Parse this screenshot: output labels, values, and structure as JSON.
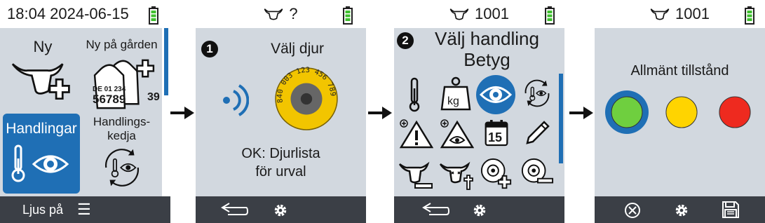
{
  "screen1": {
    "datetime": "18:04 2024-06-15",
    "tiles": {
      "ny": "Ny",
      "ny_pa_garden": "Ny på gården",
      "tag_line1": "DE 01 234",
      "tag_line2": "56789",
      "tag_side": "39",
      "handlingar": "Handlingar",
      "handlingskedja_1": "Handlings-",
      "handlingskedja_2": "kedja"
    },
    "bottom_label": "Ljus på",
    "menu_glyph": "☰"
  },
  "screen2": {
    "animal_id": "?",
    "step": "1",
    "title": "Välj djur",
    "tag_number": "840 003 123 456 789",
    "hint_line1": "OK: Djurlista",
    "hint_line2": "för urval"
  },
  "screen3": {
    "animal_id": "1001",
    "step": "2",
    "title_line1": "Välj handling",
    "title_line2": "Betyg",
    "kg_label": "kg",
    "calendar_day": "15"
  },
  "screen4": {
    "animal_id": "1001",
    "title": "Allmänt tillstånd",
    "colors": {
      "green": "#6fcf3f",
      "green_ring": "#1f6fb5",
      "yellow": "#ffd400",
      "red": "#ee2a1f"
    }
  },
  "colors": {
    "accent": "#1f6fb5",
    "battery": "#3fbf2f",
    "content_bg": "#d2d8df",
    "bar_bg": "#3b3f46"
  }
}
